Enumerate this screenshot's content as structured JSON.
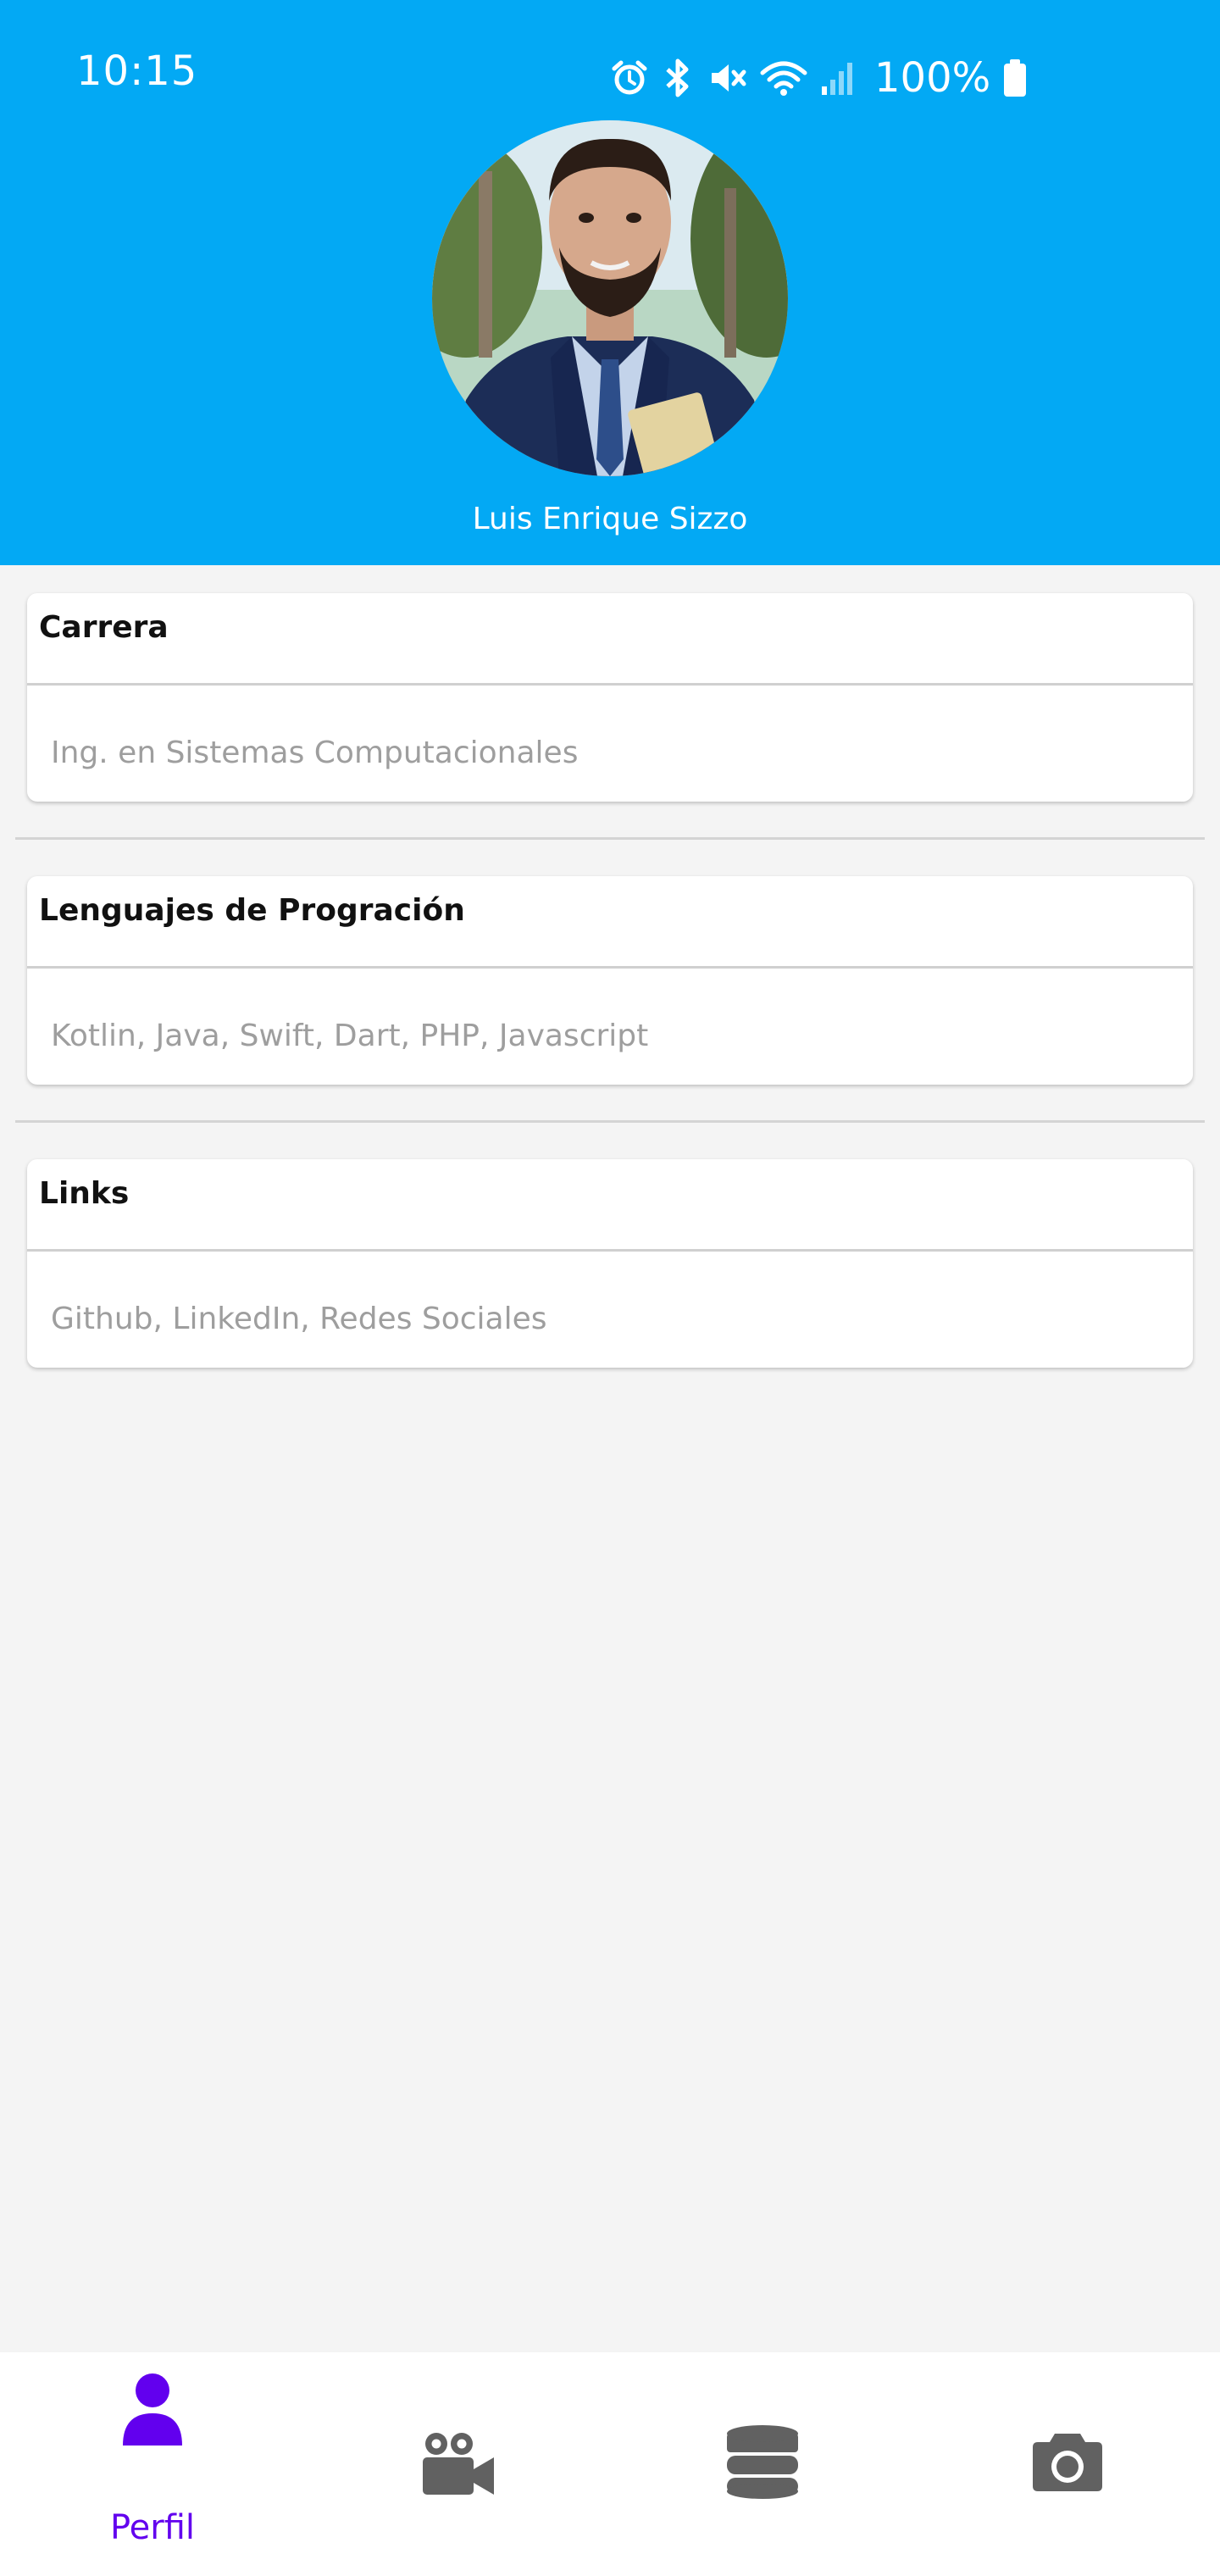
{
  "status_bar": {
    "time": "10:15",
    "battery": "100%",
    "icons": [
      "alarm-icon",
      "bluetooth-icon",
      "mute-icon",
      "wifi-icon",
      "signal-icon",
      "battery-icon"
    ]
  },
  "profile": {
    "name": "Luis Enrique Sizzo",
    "avatar": "profile-photo"
  },
  "cards": [
    {
      "title": "Carrera",
      "value": "Ing. en Sistemas Computacionales"
    },
    {
      "title": "Lenguajes de Progración",
      "value": "Kotlin, Java, Swift, Dart, PHP, Javascript"
    },
    {
      "title": "Links",
      "value": "Github, LinkedIn, Redes Sociales"
    }
  ],
  "bottom_nav": {
    "items": [
      {
        "label": "Perfil",
        "icon": "person-icon",
        "active": true
      },
      {
        "label": "",
        "icon": "video-camera-icon",
        "active": false
      },
      {
        "label": "",
        "icon": "database-icon",
        "active": false
      },
      {
        "label": "",
        "icon": "camera-icon",
        "active": false
      }
    ]
  },
  "colors": {
    "header": "#03a9f4",
    "background": "#f4f4f4",
    "nav_active": "#6200ee",
    "nav_inactive": "#616161",
    "card_value": "#9e9e9e"
  }
}
